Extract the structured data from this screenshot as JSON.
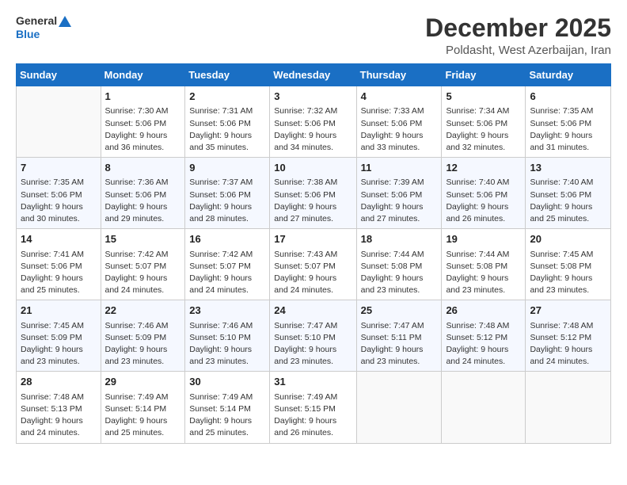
{
  "logo": {
    "line1": "General",
    "line2": "Blue"
  },
  "title": "December 2025",
  "subtitle": "Poldasht, West Azerbaijan, Iran",
  "days_of_week": [
    "Sunday",
    "Monday",
    "Tuesday",
    "Wednesday",
    "Thursday",
    "Friday",
    "Saturday"
  ],
  "weeks": [
    [
      {
        "num": "",
        "info": ""
      },
      {
        "num": "1",
        "info": "Sunrise: 7:30 AM\nSunset: 5:06 PM\nDaylight: 9 hours\nand 36 minutes."
      },
      {
        "num": "2",
        "info": "Sunrise: 7:31 AM\nSunset: 5:06 PM\nDaylight: 9 hours\nand 35 minutes."
      },
      {
        "num": "3",
        "info": "Sunrise: 7:32 AM\nSunset: 5:06 PM\nDaylight: 9 hours\nand 34 minutes."
      },
      {
        "num": "4",
        "info": "Sunrise: 7:33 AM\nSunset: 5:06 PM\nDaylight: 9 hours\nand 33 minutes."
      },
      {
        "num": "5",
        "info": "Sunrise: 7:34 AM\nSunset: 5:06 PM\nDaylight: 9 hours\nand 32 minutes."
      },
      {
        "num": "6",
        "info": "Sunrise: 7:35 AM\nSunset: 5:06 PM\nDaylight: 9 hours\nand 31 minutes."
      }
    ],
    [
      {
        "num": "7",
        "info": "Sunrise: 7:35 AM\nSunset: 5:06 PM\nDaylight: 9 hours\nand 30 minutes."
      },
      {
        "num": "8",
        "info": "Sunrise: 7:36 AM\nSunset: 5:06 PM\nDaylight: 9 hours\nand 29 minutes."
      },
      {
        "num": "9",
        "info": "Sunrise: 7:37 AM\nSunset: 5:06 PM\nDaylight: 9 hours\nand 28 minutes."
      },
      {
        "num": "10",
        "info": "Sunrise: 7:38 AM\nSunset: 5:06 PM\nDaylight: 9 hours\nand 27 minutes."
      },
      {
        "num": "11",
        "info": "Sunrise: 7:39 AM\nSunset: 5:06 PM\nDaylight: 9 hours\nand 27 minutes."
      },
      {
        "num": "12",
        "info": "Sunrise: 7:40 AM\nSunset: 5:06 PM\nDaylight: 9 hours\nand 26 minutes."
      },
      {
        "num": "13",
        "info": "Sunrise: 7:40 AM\nSunset: 5:06 PM\nDaylight: 9 hours\nand 25 minutes."
      }
    ],
    [
      {
        "num": "14",
        "info": "Sunrise: 7:41 AM\nSunset: 5:06 PM\nDaylight: 9 hours\nand 25 minutes."
      },
      {
        "num": "15",
        "info": "Sunrise: 7:42 AM\nSunset: 5:07 PM\nDaylight: 9 hours\nand 24 minutes."
      },
      {
        "num": "16",
        "info": "Sunrise: 7:42 AM\nSunset: 5:07 PM\nDaylight: 9 hours\nand 24 minutes."
      },
      {
        "num": "17",
        "info": "Sunrise: 7:43 AM\nSunset: 5:07 PM\nDaylight: 9 hours\nand 24 minutes."
      },
      {
        "num": "18",
        "info": "Sunrise: 7:44 AM\nSunset: 5:08 PM\nDaylight: 9 hours\nand 23 minutes."
      },
      {
        "num": "19",
        "info": "Sunrise: 7:44 AM\nSunset: 5:08 PM\nDaylight: 9 hours\nand 23 minutes."
      },
      {
        "num": "20",
        "info": "Sunrise: 7:45 AM\nSunset: 5:08 PM\nDaylight: 9 hours\nand 23 minutes."
      }
    ],
    [
      {
        "num": "21",
        "info": "Sunrise: 7:45 AM\nSunset: 5:09 PM\nDaylight: 9 hours\nand 23 minutes."
      },
      {
        "num": "22",
        "info": "Sunrise: 7:46 AM\nSunset: 5:09 PM\nDaylight: 9 hours\nand 23 minutes."
      },
      {
        "num": "23",
        "info": "Sunrise: 7:46 AM\nSunset: 5:10 PM\nDaylight: 9 hours\nand 23 minutes."
      },
      {
        "num": "24",
        "info": "Sunrise: 7:47 AM\nSunset: 5:10 PM\nDaylight: 9 hours\nand 23 minutes."
      },
      {
        "num": "25",
        "info": "Sunrise: 7:47 AM\nSunset: 5:11 PM\nDaylight: 9 hours\nand 23 minutes."
      },
      {
        "num": "26",
        "info": "Sunrise: 7:48 AM\nSunset: 5:12 PM\nDaylight: 9 hours\nand 24 minutes."
      },
      {
        "num": "27",
        "info": "Sunrise: 7:48 AM\nSunset: 5:12 PM\nDaylight: 9 hours\nand 24 minutes."
      }
    ],
    [
      {
        "num": "28",
        "info": "Sunrise: 7:48 AM\nSunset: 5:13 PM\nDaylight: 9 hours\nand 24 minutes."
      },
      {
        "num": "29",
        "info": "Sunrise: 7:49 AM\nSunset: 5:14 PM\nDaylight: 9 hours\nand 25 minutes."
      },
      {
        "num": "30",
        "info": "Sunrise: 7:49 AM\nSunset: 5:14 PM\nDaylight: 9 hours\nand 25 minutes."
      },
      {
        "num": "31",
        "info": "Sunrise: 7:49 AM\nSunset: 5:15 PM\nDaylight: 9 hours\nand 26 minutes."
      },
      {
        "num": "",
        "info": ""
      },
      {
        "num": "",
        "info": ""
      },
      {
        "num": "",
        "info": ""
      }
    ]
  ]
}
